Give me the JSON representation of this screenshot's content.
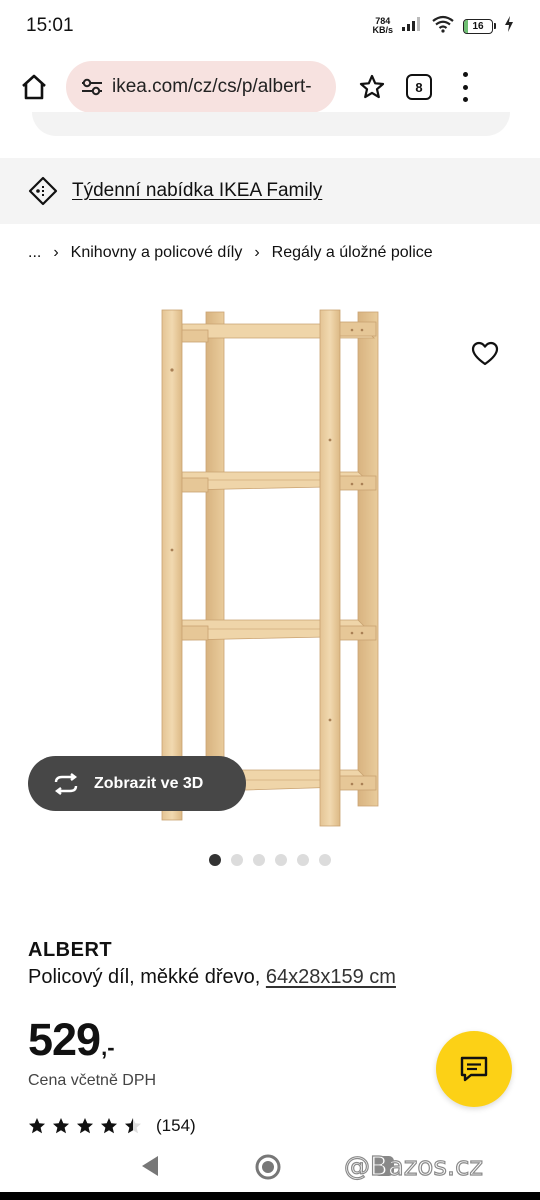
{
  "status_bar": {
    "time": "15:01",
    "speed_value": "784",
    "speed_unit": "KB/s",
    "battery": "16",
    "battery_level": 0.16
  },
  "browser": {
    "url": "ikea.com/cz/cs/p/albert-",
    "tab_count": "8"
  },
  "promo": {
    "text": "Týdenní nabídka IKEA Family"
  },
  "breadcrumb": {
    "ellipsis": "...",
    "items": [
      "Knihovny a policové díly",
      "Regály a úložné police"
    ]
  },
  "gallery": {
    "view_3d_label": "Zobrazit ve 3D",
    "slide_count": 6,
    "active_slide": 1
  },
  "product": {
    "name": "ALBERT",
    "description": "Policový díl, měkké dřevo,",
    "dimensions": "64x28x159 cm",
    "price_integer": "529",
    "price_suffix": ",-",
    "vat_note": "Cena včetně DPH",
    "rating": 4.5,
    "review_count": "(154)"
  },
  "watermark": "@Bazos.cz",
  "colors": {
    "url_bar_bg": "#f7e2e0",
    "promo_bg": "#f4f4f4",
    "chat_button": "#fcd116",
    "view3d_bg": "#474747",
    "wood": "#ecd1a5"
  },
  "icons": {
    "home": "home-icon",
    "site_settings": "tune-icon",
    "bookmark": "star-outline-icon",
    "menu": "more-vertical-icon",
    "promo": "price-tag-icon",
    "favourite": "heart-outline-icon",
    "view3d": "rotate-3d-icon",
    "chat": "chat-icon"
  }
}
